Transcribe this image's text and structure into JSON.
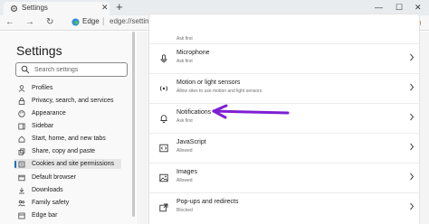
{
  "browser": {
    "tab_title": "Settings",
    "tab_close": "✕",
    "new_tab": "+",
    "window_controls": [
      "—",
      "☐",
      "✕"
    ],
    "nav_buttons": [
      "←",
      "→",
      "↻"
    ],
    "address_brand": "Edge",
    "address_separator": "|",
    "address_url": "edge://settings/content",
    "toolbar_icons": [
      "☆",
      "✩",
      "⧉",
      "⋯"
    ]
  },
  "sidebar": {
    "title": "Settings",
    "search_placeholder": "Search settings",
    "items": [
      {
        "label": "Profiles",
        "icon": "profile-icon"
      },
      {
        "label": "Privacy, search, and services",
        "icon": "lock-icon"
      },
      {
        "label": "Appearance",
        "icon": "appearance-icon"
      },
      {
        "label": "Sidebar",
        "icon": "sidebar-icon"
      },
      {
        "label": "Start, home, and new tabs",
        "icon": "home-icon"
      },
      {
        "label": "Share, copy and paste",
        "icon": "share-icon"
      },
      {
        "label": "Cookies and site permissions",
        "icon": "cookies-icon",
        "active": true
      },
      {
        "label": "Default browser",
        "icon": "browser-icon"
      },
      {
        "label": "Downloads",
        "icon": "download-icon"
      },
      {
        "label": "Family safety",
        "icon": "family-icon"
      },
      {
        "label": "Edge bar",
        "icon": "edge-bar-icon"
      }
    ]
  },
  "permissions": [
    {
      "title": "",
      "subtitle": "Ask first",
      "icon": ""
    },
    {
      "title": "Microphone",
      "subtitle": "Ask first",
      "icon": "microphone-icon"
    },
    {
      "title": "Motion or light sensors",
      "subtitle": "Allow sites to use motion and light sensors",
      "icon": "sensor-icon"
    },
    {
      "title": "Notifications",
      "subtitle": "Ask first",
      "icon": "bell-icon"
    },
    {
      "title": "JavaScript",
      "subtitle": "Allowed",
      "icon": "code-icon"
    },
    {
      "title": "Images",
      "subtitle": "Allowed",
      "icon": "image-icon"
    },
    {
      "title": "Pop-ups and redirects",
      "subtitle": "Blocked",
      "icon": "popup-icon"
    }
  ],
  "colors": {
    "accent": "#0f6cbd",
    "annotation_arrow": "#7e1fd4"
  }
}
